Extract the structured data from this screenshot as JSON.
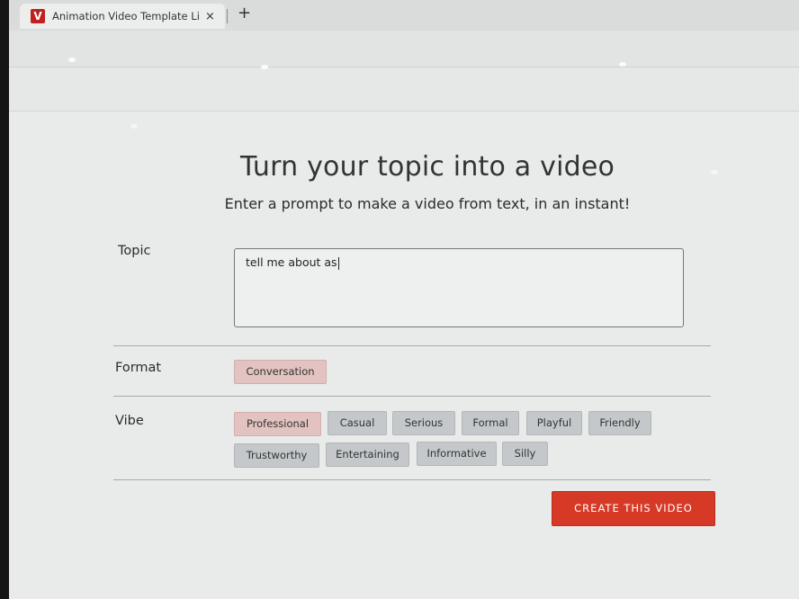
{
  "browser": {
    "tab_title": "Animation Video Template Libr",
    "tab_favicon": "V",
    "close_glyph": "×",
    "new_tab_glyph": "+"
  },
  "page": {
    "headline": "Turn your topic into a video",
    "subheadline": "Enter a prompt to make a video from text, in an instant!"
  },
  "topic": {
    "label": "Topic",
    "value": "tell me about as"
  },
  "format": {
    "label": "Format",
    "options": [
      {
        "label": "Conversation",
        "selected": true
      }
    ]
  },
  "vibe": {
    "label": "Vibe",
    "options": [
      {
        "label": "Professional",
        "selected": true
      },
      {
        "label": "Casual",
        "selected": false
      },
      {
        "label": "Serious",
        "selected": false
      },
      {
        "label": "Formal",
        "selected": false
      },
      {
        "label": "Playful",
        "selected": false
      },
      {
        "label": "Friendly",
        "selected": false
      },
      {
        "label": "Trustworthy",
        "selected": false
      },
      {
        "label": "Entertaining",
        "selected": false
      },
      {
        "label": "Informative",
        "selected": false
      },
      {
        "label": "Silly",
        "selected": false
      }
    ]
  },
  "actions": {
    "create_label": "CREATE THIS VIDEO"
  },
  "colors": {
    "accent": "#d63a27",
    "selected_chip": "#e3c3c1",
    "chip": "#c4c8ca"
  }
}
